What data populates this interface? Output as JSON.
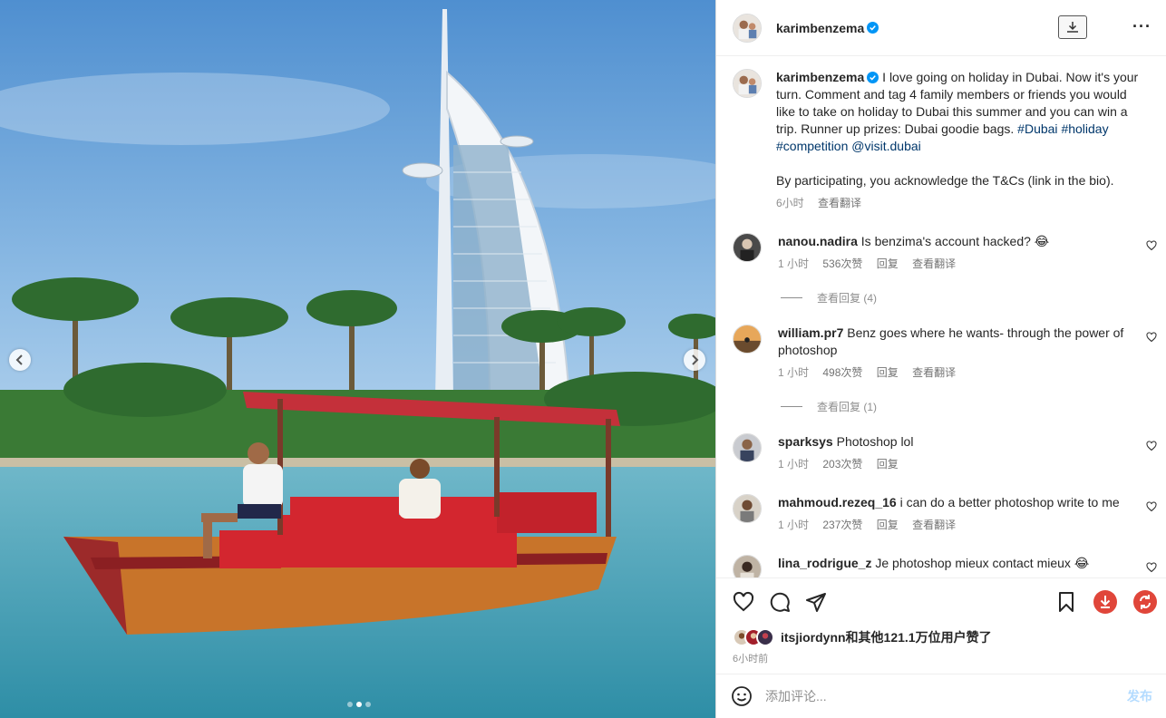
{
  "post": {
    "author": "karimbenzema",
    "caption_text": "I love going on holiday in Dubai. Now it's your turn. Comment and tag 4 family members or friends you would like to take on holiday to Dubai this summer and you can win a trip. Runner up prizes: Dubai goodie bags.",
    "caption_tags": [
      "#Dubai",
      "#holiday",
      "#competition",
      "@visit.dubai"
    ],
    "caption_footer": "By participating, you acknowledge the T&Cs (link in the bio).",
    "caption_time": "6小时",
    "translate_label": "查看翻译"
  },
  "comments": [
    {
      "user": "nanou.nadira",
      "text": "Is benzima's account hacked? 😂",
      "time": "1 小时",
      "likes": "536次赞",
      "reply": "回复",
      "translate": "查看翻译",
      "view_replies": "查看回复 (4)"
    },
    {
      "user": "william.pr7",
      "text": "Benz goes where he wants- through the power of photoshop",
      "time": "1 小时",
      "likes": "498次赞",
      "reply": "回复",
      "translate": "查看翻译",
      "view_replies": "查看回复 (1)"
    },
    {
      "user": "sparksys",
      "text": "Photoshop lol",
      "time": "1 小时",
      "likes": "203次赞",
      "reply": "回复"
    },
    {
      "user": "mahmoud.rezeq_16",
      "text": "i can do a better photoshop write to me",
      "time": "1 小时",
      "likes": "237次赞",
      "reply": "回复",
      "translate": "查看翻译"
    },
    {
      "user": "lina_rodrigue_z",
      "text": "Je photoshop mieux contact mieux 😂"
    }
  ],
  "likes_summary": "itsjiordynn和其他121.1万位用户赞了",
  "posted_ago": "6小时前",
  "comment_box": {
    "placeholder": "添加评论...",
    "post_label": "发布"
  },
  "colors": {
    "accent_blue": "#0095f6",
    "link": "#00376b",
    "download_red": "#e0463a"
  },
  "icons": [
    "download-icon",
    "more-icon",
    "heart-icon",
    "comment-icon",
    "share-icon",
    "bookmark-icon",
    "download-circle-icon",
    "repost-icon",
    "emoji-icon"
  ]
}
